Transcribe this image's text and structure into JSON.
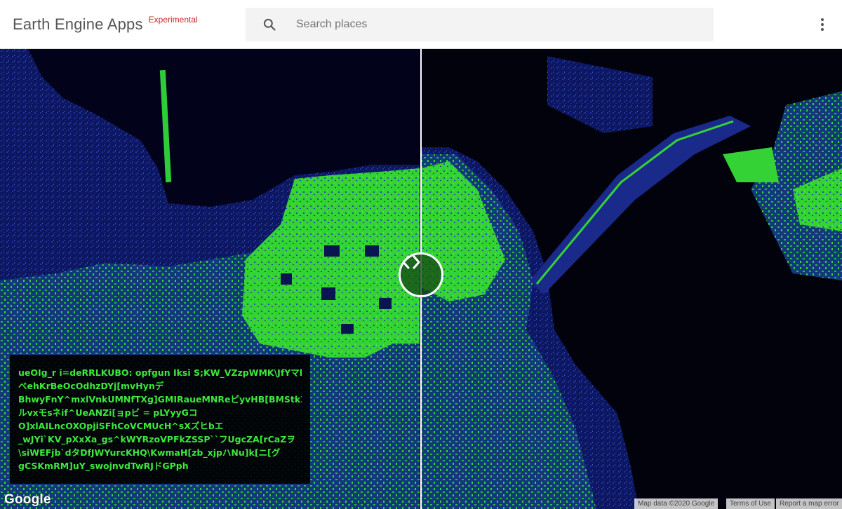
{
  "header": {
    "brand_title": "Earth Engine Apps",
    "brand_tag": "Experimental",
    "search_placeholder": "Search places",
    "search_icon": "search-icon",
    "menu_icon": "more-vert-icon"
  },
  "map": {
    "land_color": "#3ee83e",
    "water_color": "#02031a",
    "low_color": "#1a2a8a",
    "handle_icon": "swipe-arrows-icon"
  },
  "info_panel": {
    "lines": [
      "ueOIg_r i=deRRLKUBO: opfgun Iksi S;KW_VZzpWMK\\JfYマbSk",
      "べehKrBeOcOdhzDYj[mvHynデ",
      "BhwyFnY^mxlVnkUMNfTXg]GMIRaueMNReピyvHB[BMStkXtpu",
      "ルvxモsネif^UeANZi[ョpビ = pLYyyGコ",
      "O]xlAILncOXOpjiSFhCoVCMUcH^sXズヒbエ",
      "_wJYi`KV_pXxXa_gs^kWYRzoVPFkZSSP``フUgcZA[rCaZヲ",
      "\\siWEFjb`dタDfJWYurcKHQ\\KwmaH[zb_xjpハNu]k[ニ[グ",
      "gCSKmRM]uY_swojnvdTwRJドGPph"
    ]
  },
  "footer": {
    "google_logo": "Google",
    "map_data": "Map data ©2020 Google",
    "terms": "Terms of Use",
    "report": "Report a map error"
  }
}
